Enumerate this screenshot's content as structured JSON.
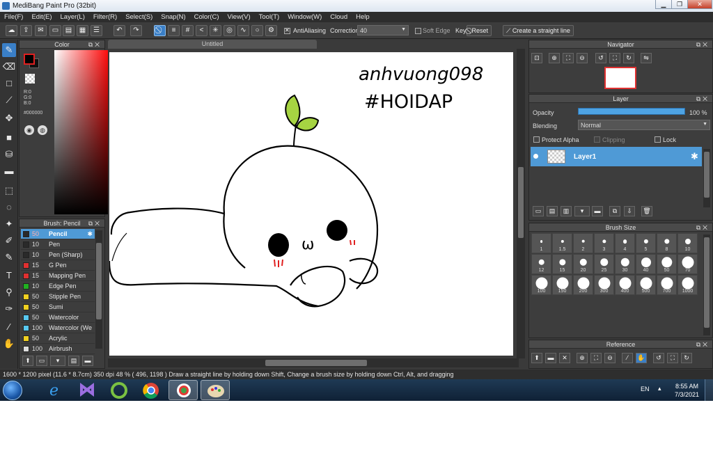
{
  "window": {
    "title": "MediBang Paint Pro (32bit)",
    "controls": {
      "minimize": "▁",
      "maximize": "❐",
      "close": "✕"
    }
  },
  "menu": [
    "File(F)",
    "Edit(E)",
    "Layer(L)",
    "Filter(R)",
    "Select(S)",
    "Snap(N)",
    "Color(C)",
    "View(V)",
    "Tool(T)",
    "Window(W)",
    "Cloud",
    "Help"
  ],
  "toolbar": {
    "antialiasing_label": "AntiAliasing",
    "correction_label": "Correction",
    "correction_value": "40",
    "soft_edge_label": "Soft Edge",
    "key_label": "Key",
    "reset_label": "Reset",
    "straight_line_label": "Create a straight line"
  },
  "color_panel": {
    "title": "Color",
    "r": "R:0",
    "g": "G:0",
    "b": "B:0",
    "hex": "#000000"
  },
  "brush_panel": {
    "title": "Brush: Pencil",
    "items": [
      {
        "size": "50",
        "name": "Pencil",
        "color": "#2a2a2a",
        "selected": true
      },
      {
        "size": "10",
        "name": "Pen",
        "color": "#2a2a2a"
      },
      {
        "size": "10",
        "name": "Pen (Sharp)",
        "color": "#2a2a2a"
      },
      {
        "size": "15",
        "name": "G Pen",
        "color": "#e03030"
      },
      {
        "size": "15",
        "name": "Mapping Pen",
        "color": "#e03030"
      },
      {
        "size": "10",
        "name": "Edge Pen",
        "color": "#20b020"
      },
      {
        "size": "50",
        "name": "Stipple Pen",
        "color": "#f0d020"
      },
      {
        "size": "50",
        "name": "Sumi",
        "color": "#f0d020"
      },
      {
        "size": "50",
        "name": "Watercolor",
        "color": "#58c8f0"
      },
      {
        "size": "100",
        "name": "Watercolor (We",
        "color": "#58c8f0"
      },
      {
        "size": "50",
        "name": "Acrylic",
        "color": "#f0d020"
      },
      {
        "size": "100",
        "name": "Airbrush",
        "color": "#dddddd"
      }
    ]
  },
  "document": {
    "tab_title": "Untitled",
    "handwriting_line1": "anhvuong098",
    "handwriting_line2": "#HOIDAP",
    "mouth": "ω"
  },
  "navigator": {
    "title": "Navigator"
  },
  "layer_panel": {
    "title": "Layer",
    "opacity_label": "Opacity",
    "opacity_value": "100 %",
    "opacity": 1.0,
    "blending_label": "Blending",
    "blending_value": "Normal",
    "protect_alpha_label": "Protect Alpha",
    "clipping_label": "Clipping",
    "lock_label": "Lock",
    "layer_name": "Layer1"
  },
  "brush_size_panel": {
    "title": "Brush Size",
    "sizes": [
      "1",
      "1.5",
      "2",
      "3",
      "4",
      "5",
      "8",
      "10",
      "12",
      "15",
      "20",
      "25",
      "30",
      "40",
      "50",
      "70",
      "100",
      "150",
      "200",
      "300",
      "400",
      "500",
      "700",
      "1000"
    ]
  },
  "reference_panel": {
    "title": "Reference"
  },
  "status": {
    "text": "1600 * 1200 pixel   (11.6 * 8.7cm)  350 dpi  48 %   ( 496, 1198 )  Draw a straight line by holding down Shift, Change a brush size by holding down Ctrl, Alt, and dragging"
  },
  "taskbar": {
    "language": "EN",
    "time": "8:55 AM",
    "date": "7/3/2021"
  },
  "colors": {
    "accent": "#4f9ad6",
    "panel": "#3d3d3d",
    "taskbar": "#0f2136"
  }
}
